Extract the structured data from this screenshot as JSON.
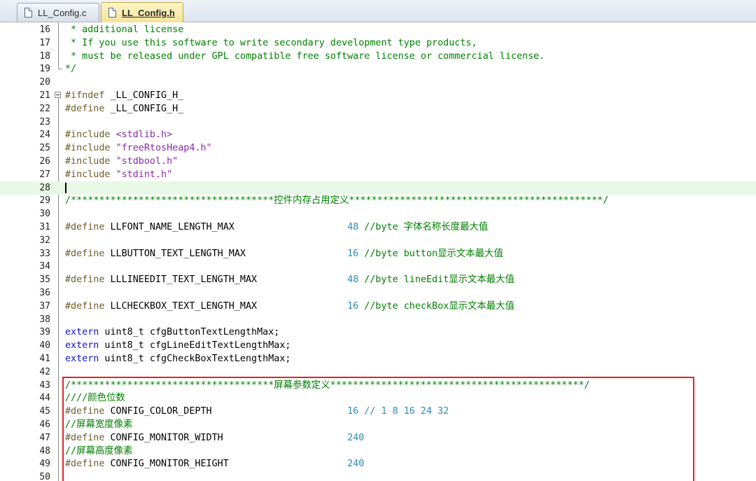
{
  "tabs": [
    {
      "label": "LL_Config.c",
      "active": false
    },
    {
      "label": "LL_Config.h",
      "active": true
    }
  ],
  "colors": {
    "comment": "#008000",
    "preprocessor": "#6d5d2a",
    "string": "#8c2aa8",
    "number": "#2a8cb4",
    "keyword": "#1010d0",
    "highlight_box": "#d9262c",
    "current_line": "#e8f8e6"
  },
  "editor": {
    "current_line": "28",
    "lines": [
      {
        "n": "16",
        "parts": [
          {
            "t": " * additional license",
            "c": "comment"
          }
        ]
      },
      {
        "n": "17",
        "parts": [
          {
            "t": " * If you use this software to write secondary development type products,",
            "c": "comment"
          }
        ]
      },
      {
        "n": "18",
        "parts": [
          {
            "t": " * must be released under GPL compatible free software license or commercial license.",
            "c": "comment"
          }
        ]
      },
      {
        "n": "19",
        "parts": [
          {
            "t": "*/",
            "c": "comment"
          }
        ]
      },
      {
        "n": "20",
        "parts": []
      },
      {
        "n": "21",
        "parts": [
          {
            "t": "#ifndef",
            "c": "pp"
          },
          {
            "t": " _LL_CONFIG_H_",
            "c": "mac"
          }
        ]
      },
      {
        "n": "22",
        "parts": [
          {
            "t": "#define",
            "c": "pp"
          },
          {
            "t": " _LL_CONFIG_H_",
            "c": "mac"
          }
        ]
      },
      {
        "n": "23",
        "parts": []
      },
      {
        "n": "24",
        "parts": [
          {
            "t": "#include",
            "c": "pp"
          },
          {
            "t": " ",
            "c": "txt"
          },
          {
            "t": "<stdlib.h>",
            "c": "str"
          }
        ]
      },
      {
        "n": "25",
        "parts": [
          {
            "t": "#include",
            "c": "pp"
          },
          {
            "t": " ",
            "c": "txt"
          },
          {
            "t": "\"freeRtosHeap4.h\"",
            "c": "str"
          }
        ]
      },
      {
        "n": "26",
        "parts": [
          {
            "t": "#include",
            "c": "pp"
          },
          {
            "t": " ",
            "c": "txt"
          },
          {
            "t": "\"stdbool.h\"",
            "c": "str"
          }
        ]
      },
      {
        "n": "27",
        "parts": [
          {
            "t": "#include",
            "c": "pp"
          },
          {
            "t": " ",
            "c": "txt"
          },
          {
            "t": "\"stdint.h\"",
            "c": "str"
          }
        ]
      },
      {
        "n": "28",
        "parts": []
      },
      {
        "n": "29",
        "parts": [
          {
            "t": "/************************************",
            "c": "comment"
          },
          {
            "t": "控件内存占用定义",
            "c": "comment cjk"
          },
          {
            "t": "*********************************************/",
            "c": "comment"
          }
        ]
      },
      {
        "n": "30",
        "parts": []
      },
      {
        "n": "31",
        "parts": [
          {
            "t": "#define",
            "c": "pp"
          },
          {
            "t": " LLFONT_NAME_LENGTH_MAX                    ",
            "c": "mac"
          },
          {
            "t": "48",
            "c": "num"
          },
          {
            "t": " //byte ",
            "c": "comment"
          },
          {
            "t": "字体名称长度最大值",
            "c": "comment cjk"
          }
        ]
      },
      {
        "n": "32",
        "parts": []
      },
      {
        "n": "33",
        "parts": [
          {
            "t": "#define",
            "c": "pp"
          },
          {
            "t": " LLBUTTON_TEXT_LENGTH_MAX                  ",
            "c": "mac"
          },
          {
            "t": "16",
            "c": "num"
          },
          {
            "t": " //byte button",
            "c": "comment"
          },
          {
            "t": "显示文本最大值",
            "c": "comment cjk"
          }
        ]
      },
      {
        "n": "34",
        "parts": []
      },
      {
        "n": "35",
        "parts": [
          {
            "t": "#define",
            "c": "pp"
          },
          {
            "t": " LLLINEEDIT_TEXT_LENGTH_MAX                ",
            "c": "mac"
          },
          {
            "t": "48",
            "c": "num"
          },
          {
            "t": " //byte lineEdit",
            "c": "comment"
          },
          {
            "t": "显示文本最大值",
            "c": "comment cjk"
          }
        ]
      },
      {
        "n": "36",
        "parts": []
      },
      {
        "n": "37",
        "parts": [
          {
            "t": "#define",
            "c": "pp"
          },
          {
            "t": " LLCHECKBOX_TEXT_LENGTH_MAX                ",
            "c": "mac"
          },
          {
            "t": "16",
            "c": "num"
          },
          {
            "t": " //byte checkBox",
            "c": "comment"
          },
          {
            "t": "显示文本最大值",
            "c": "comment cjk"
          }
        ]
      },
      {
        "n": "38",
        "parts": []
      },
      {
        "n": "39",
        "parts": [
          {
            "t": "extern",
            "c": "kw"
          },
          {
            "t": " uint8_t cfgButtonTextLengthMax;",
            "c": "txt"
          }
        ]
      },
      {
        "n": "40",
        "parts": [
          {
            "t": "extern",
            "c": "kw"
          },
          {
            "t": " uint8_t cfgLineEditTextLengthMax;",
            "c": "txt"
          }
        ]
      },
      {
        "n": "41",
        "parts": [
          {
            "t": "extern",
            "c": "kw"
          },
          {
            "t": " uint8_t cfgCheckBoxTextLengthMax;",
            "c": "txt"
          }
        ]
      },
      {
        "n": "42",
        "parts": []
      },
      {
        "n": "43",
        "parts": [
          {
            "t": "/************************************",
            "c": "comment"
          },
          {
            "t": "屏幕参数定义",
            "c": "comment cjk"
          },
          {
            "t": "*********************************************/",
            "c": "comment"
          }
        ]
      },
      {
        "n": "44",
        "parts": [
          {
            "t": "////",
            "c": "comment"
          },
          {
            "t": "颜色位数",
            "c": "comment cjk"
          }
        ]
      },
      {
        "n": "45",
        "parts": [
          {
            "t": "#define",
            "c": "pp"
          },
          {
            "t": " CONFIG_COLOR_DEPTH                        ",
            "c": "mac"
          },
          {
            "t": "16",
            "c": "num"
          },
          {
            "t": " // 1 8 16 24 32",
            "c": "num"
          }
        ]
      },
      {
        "n": "46",
        "parts": [
          {
            "t": "//",
            "c": "comment"
          },
          {
            "t": "屏幕宽度像素",
            "c": "comment cjk"
          }
        ]
      },
      {
        "n": "47",
        "parts": [
          {
            "t": "#define",
            "c": "pp"
          },
          {
            "t": " CONFIG_MONITOR_WIDTH                      ",
            "c": "mac"
          },
          {
            "t": "240",
            "c": "num"
          }
        ]
      },
      {
        "n": "48",
        "parts": [
          {
            "t": "//",
            "c": "comment"
          },
          {
            "t": "屏幕高度像素",
            "c": "comment cjk"
          }
        ]
      },
      {
        "n": "49",
        "parts": [
          {
            "t": "#define",
            "c": "pp"
          },
          {
            "t": " CONFIG_MONITOR_HEIGHT                     ",
            "c": "mac"
          },
          {
            "t": "240",
            "c": "num"
          }
        ]
      },
      {
        "n": "50",
        "parts": []
      }
    ]
  }
}
